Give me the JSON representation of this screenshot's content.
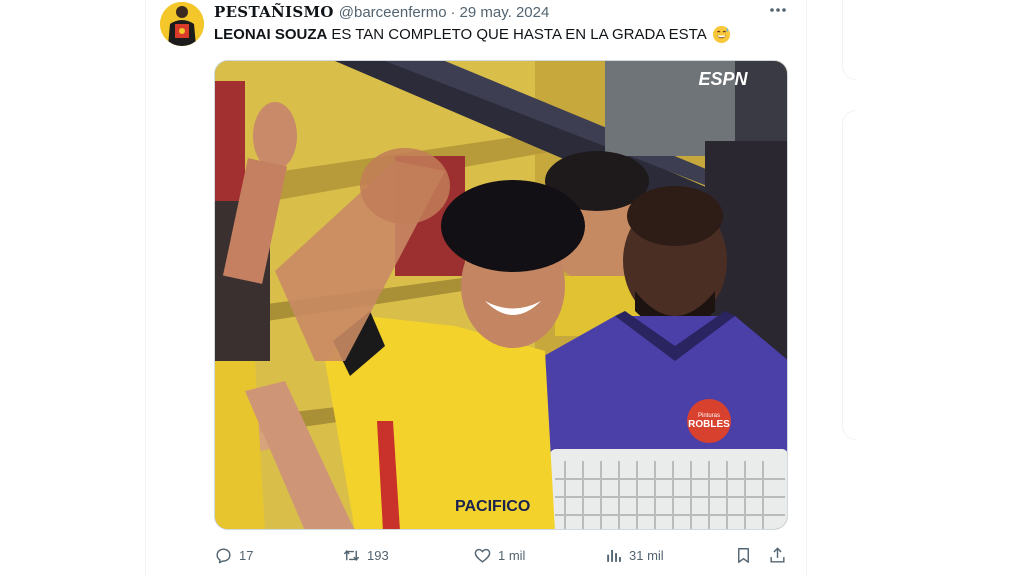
{
  "tweet": {
    "display_name": "PESTAÑISMO",
    "handle": "@barceenfermo",
    "separator": "·",
    "date": "29 may. 2024",
    "text_bold": "LEONAI SOUZA",
    "text_rest": "ES TAN COMPLETO QUE HASTA EN LA GRADA ESTA",
    "emoji_icon": "grinning-sweat-face-icon",
    "media": {
      "watermark": "ESPN",
      "bib_brand_top": "Pinturas",
      "bib_brand": "ROBLES",
      "jersey_text": "PACIFICO"
    },
    "actions": {
      "replies": "17",
      "reposts": "193",
      "likes": "1 mil",
      "views": "31 mil"
    }
  },
  "colors": {
    "text": "#0f1419",
    "secondary": "#536471",
    "border": "#eff3f4",
    "jersey_yellow": "#f2d22b",
    "bib_purple": "#4b3fa8"
  }
}
